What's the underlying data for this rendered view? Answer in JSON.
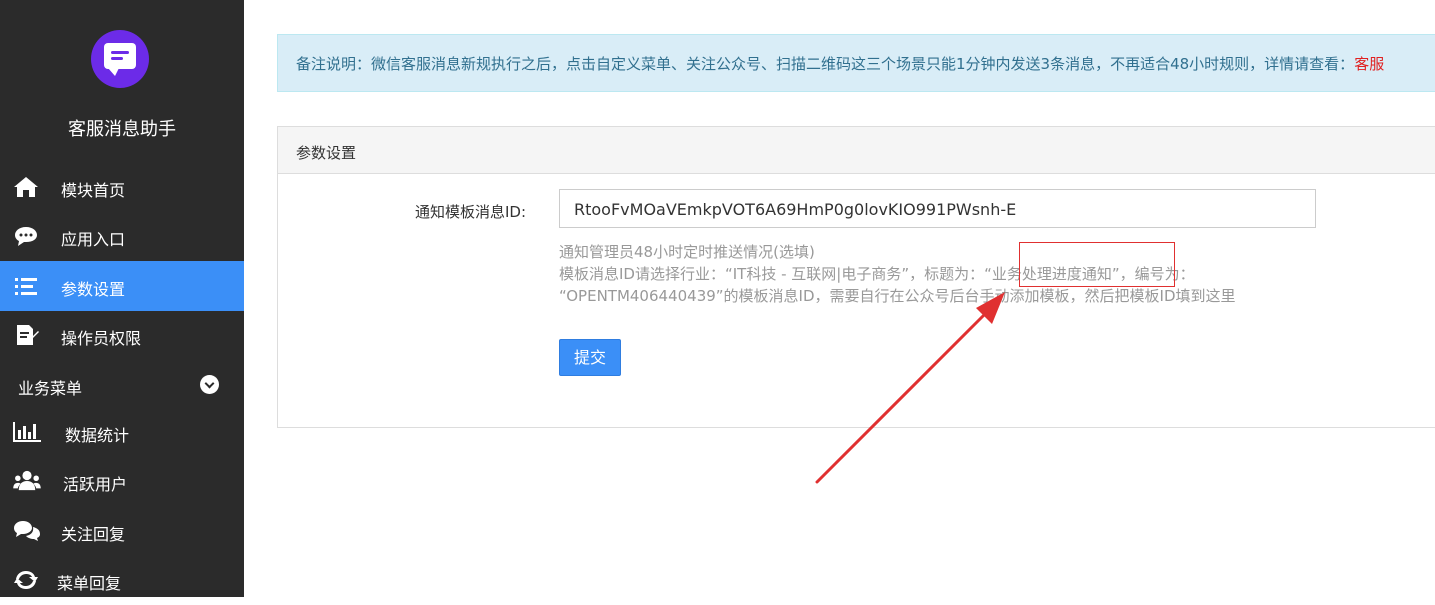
{
  "sidebar": {
    "app_title": "客服消息助手",
    "items": [
      {
        "label": "模块首页",
        "icon": "home-icon"
      },
      {
        "label": "应用入口",
        "icon": "chat-bubble-icon"
      },
      {
        "label": "参数设置",
        "icon": "list-icon",
        "active": true
      },
      {
        "label": "操作员权限",
        "icon": "edit-document-icon"
      }
    ],
    "section": {
      "label": "业务菜单",
      "icon": "chevron-down-icon"
    },
    "business_items": [
      {
        "label": "数据统计",
        "icon": "bar-chart-icon"
      },
      {
        "label": "活跃用户",
        "icon": "users-icon"
      },
      {
        "label": "关注回复",
        "icon": "chat-bubbles-icon"
      },
      {
        "label": "菜单回复",
        "icon": "refresh-icon"
      }
    ]
  },
  "notice": {
    "text": "备注说明：微信客服消息新规执行之后，点击自定义菜单、关注公众号、扫描二维码这三个场景只能1分钟内发送3条消息，不再适合48小时规则，详情请查看：",
    "link_text": "客服"
  },
  "panel": {
    "title": "参数设置",
    "field_label": "通知模板消息ID:",
    "field_value": "RtooFvMOaVEmkpVOT6A69HmP0g0lovKIO991PWsnh-E",
    "help_line1": "通知管理员48小时定时推送情况(选填)",
    "help_line2": "模板消息ID请选择行业：“IT科技 - 互联网|电子商务”，标题为：“业务处理进度通知”，编号为：",
    "help_line3": "“OPENTM406440439”的模板消息ID，需要自行在公众号后台手动添加模板，然后把模板ID填到这里",
    "submit_label": "提交"
  },
  "colors": {
    "sidebar_bg": "#2b2b2b",
    "active_item": "#3b8ff7",
    "logo": "#6c2be8",
    "annotation": "#e03030"
  }
}
